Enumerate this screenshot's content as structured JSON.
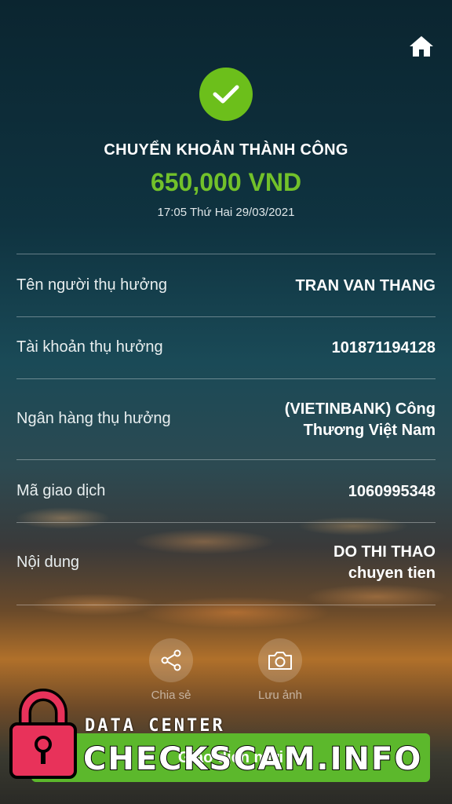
{
  "header": {
    "home_icon": "home-icon",
    "status_icon": "check-icon",
    "title": "CHUYỂN KHOẢN THÀNH CÔNG",
    "amount": "650,000 VND",
    "datetime": "17:05 Thứ Hai 29/03/2021"
  },
  "details": [
    {
      "label": "Tên người thụ hưởng",
      "value": "TRAN VAN THANG"
    },
    {
      "label": "Tài khoản thụ hưởng",
      "value": "101871194128"
    },
    {
      "label": "Ngân hàng thụ hưởng",
      "value": "(VIETINBANK) Công Thương Việt Nam"
    },
    {
      "label": "Mã giao dịch",
      "value": "1060995348"
    },
    {
      "label": "Nội dung",
      "value": "DO THI THAO chuyen tien"
    }
  ],
  "actions": {
    "share": {
      "label": "Chia sẻ",
      "icon": "share-icon"
    },
    "save_image": {
      "label": "Lưu ảnh",
      "icon": "camera-icon"
    }
  },
  "bottom_button": {
    "label": "Giao dịch mới"
  },
  "watermark": {
    "line1": "DATA CENTER",
    "line2": "CHECKSCAM.INFO",
    "icon": "lock-icon"
  },
  "colors": {
    "accent": "#6cbf1b",
    "amount": "#72c12a",
    "watermark_lock": "#e8325a"
  }
}
